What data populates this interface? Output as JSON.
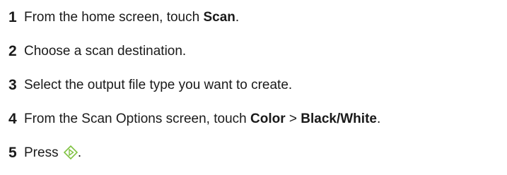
{
  "steps": [
    {
      "number": "1",
      "pre": "From the home screen, touch ",
      "bold": "Scan",
      "post": "."
    },
    {
      "number": "2",
      "text": "Choose a scan destination."
    },
    {
      "number": "3",
      "text": "Select the output file type you want to create."
    },
    {
      "number": "4",
      "pre": "From the Scan Options screen, touch ",
      "bold1": "Color",
      "mid": " > ",
      "bold2": "Black/White",
      "post": "."
    },
    {
      "number": "5",
      "pre": "Press ",
      "icon": "start-button-icon",
      "post": "."
    }
  ],
  "colors": {
    "text": "#1a1a1a",
    "icon": "#7fc241"
  }
}
